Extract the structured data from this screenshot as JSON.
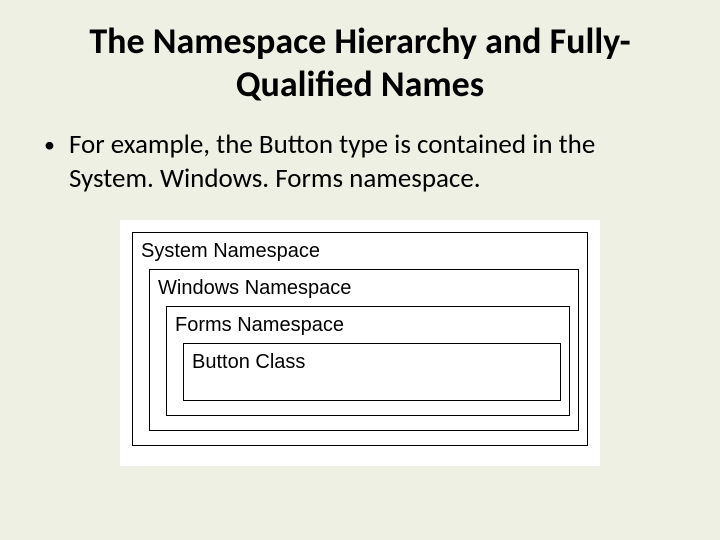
{
  "title": "The Namespace Hierarchy and Fully-Qualified Names",
  "bullet": "For example, the Button type is contained in the System. Windows. Forms namespace.",
  "diagram": {
    "level0": "System Namespace",
    "level1": "Windows Namespace",
    "level2": "Forms Namespace",
    "level3": "Button Class"
  }
}
